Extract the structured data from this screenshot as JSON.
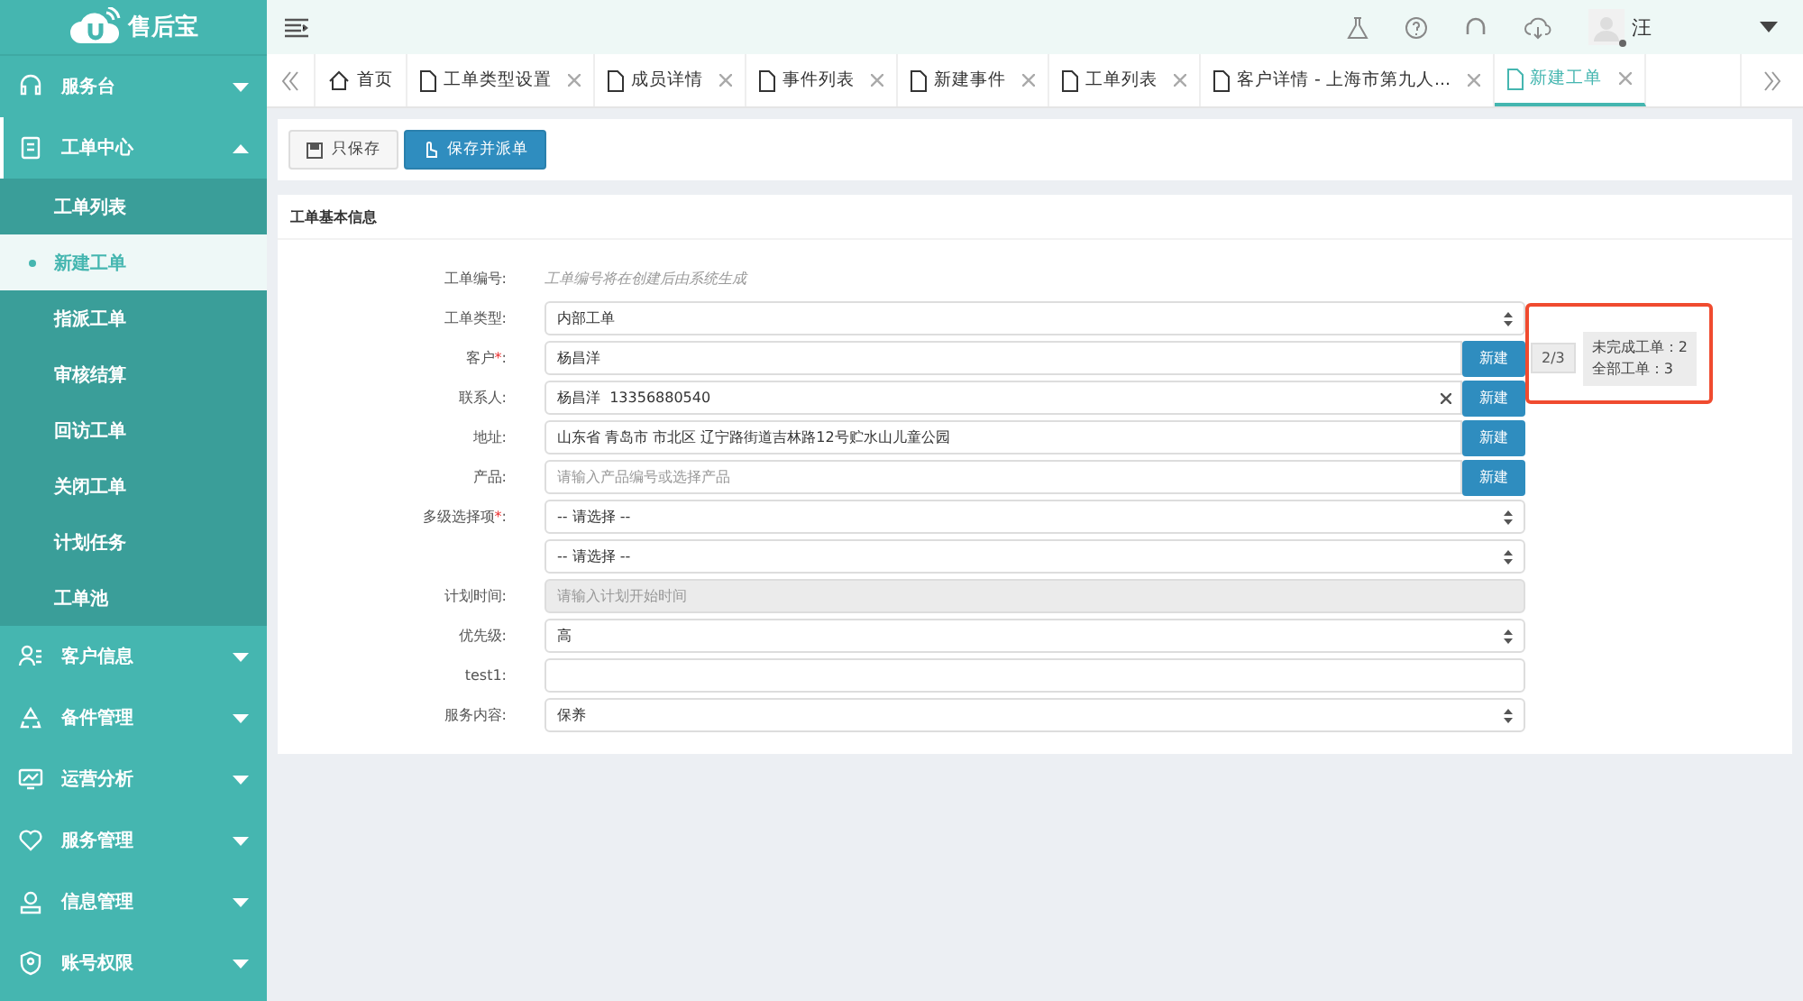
{
  "sidebar": {
    "logo": "售后宝",
    "items": [
      {
        "label": "服务台",
        "expanded": false
      },
      {
        "label": "工单中心",
        "expanded": true,
        "children": [
          {
            "label": "工单列表",
            "selected": false
          },
          {
            "label": "新建工单",
            "selected": true
          },
          {
            "label": "指派工单",
            "selected": false
          },
          {
            "label": "审核结算",
            "selected": false
          },
          {
            "label": "回访工单",
            "selected": false
          },
          {
            "label": "关闭工单",
            "selected": false
          },
          {
            "label": "计划任务",
            "selected": false
          },
          {
            "label": "工单池",
            "selected": false
          }
        ]
      },
      {
        "label": "客户信息",
        "expanded": false
      },
      {
        "label": "备件管理",
        "expanded": false
      },
      {
        "label": "运营分析",
        "expanded": false
      },
      {
        "label": "服务管理",
        "expanded": false
      },
      {
        "label": "信息管理",
        "expanded": false
      },
      {
        "label": "账号权限",
        "expanded": false
      }
    ]
  },
  "topbar": {
    "user": "汪"
  },
  "tabs": [
    {
      "label": "首页",
      "kind": "home",
      "selected": false
    },
    {
      "label": "工单类型设置",
      "kind": "page",
      "selected": false
    },
    {
      "label": "成员详情",
      "kind": "page",
      "selected": false
    },
    {
      "label": "事件列表",
      "kind": "page",
      "selected": false
    },
    {
      "label": "新建事件",
      "kind": "page",
      "selected": false
    },
    {
      "label": "工单列表",
      "kind": "page",
      "selected": false
    },
    {
      "label": "客户详情 - 上海市第九人...",
      "kind": "page",
      "selected": false
    },
    {
      "label": "新建工单",
      "kind": "page",
      "selected": true
    }
  ],
  "toolbar": {
    "buttons": [
      {
        "label": "只保存",
        "kind": "default"
      },
      {
        "label": "保存并派单",
        "kind": "primary"
      }
    ]
  },
  "form": {
    "title": "工单基本信息",
    "rows": [
      {
        "label": "工单编号:",
        "kind": "note",
        "value": "工单编号将在创建后由系统生成"
      },
      {
        "label": "工单类型:",
        "kind": "select",
        "value": "内部工单"
      },
      {
        "label": "客户",
        "required_mark": "*",
        "label_suffix": ":",
        "kind": "input-button",
        "value": "杨昌洋",
        "button": "新建"
      },
      {
        "label": "联系人:",
        "kind": "input-clear-button",
        "value": "杨昌洋  13356880540",
        "button": "新建"
      },
      {
        "label": "地址:",
        "kind": "input-button",
        "value": "山东省 青岛市 市北区 辽宁路街道吉林路12号贮水山儿童公园",
        "button": "新建"
      },
      {
        "label": "产品:",
        "kind": "input-button",
        "placeholder": "请输入产品编号或选择产品",
        "button": "新建"
      },
      {
        "label": "多级选择项",
        "required_mark": "*",
        "label_suffix": ":",
        "kind": "select",
        "value": "-- 请选择 --"
      },
      {
        "kind": "select",
        "value": "-- 请选择 --"
      },
      {
        "label": "计划时间:",
        "kind": "disabled-input",
        "placeholder": "请输入计划开始时间"
      },
      {
        "label": "优先级:",
        "kind": "select",
        "value": "高"
      },
      {
        "label": "test1:",
        "kind": "input"
      },
      {
        "label": "服务内容:",
        "kind": "select",
        "value": "保养"
      }
    ]
  },
  "customer_stats": {
    "badge": "2/3",
    "lines": [
      "未完成工单：2",
      "全部工单：3"
    ]
  }
}
